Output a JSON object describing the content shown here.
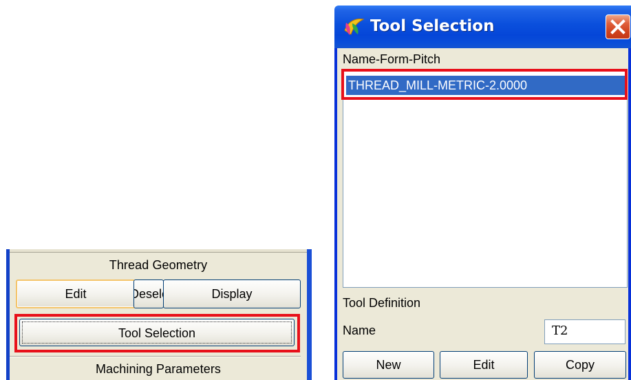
{
  "left_panel": {
    "section_title": "Thread Geometry",
    "edit_label": "Edit",
    "deselect_label": "Deselect",
    "display_label": "Display",
    "tool_selection_label": "Tool Selection",
    "machining_title": "Machining Parameters"
  },
  "dialog": {
    "title": "Tool Selection",
    "list_header": "Name-Form-Pitch",
    "list_items": [
      "THREAD_MILL-METRIC-2.0000"
    ],
    "tool_definition_label": "Tool Definition",
    "name_label": "Name",
    "name_value": "T2",
    "new_label": "New",
    "edit_label": "Edit",
    "copy_label": "Copy"
  },
  "colors": {
    "highlight_red": "#e8101a",
    "titlebar_blue": "#0a4fdc",
    "selection_blue": "#316ac5",
    "panel_bg": "#ece9d8"
  },
  "icons": {
    "app_icon": "app-logo-icon",
    "close_icon": "close-icon"
  }
}
